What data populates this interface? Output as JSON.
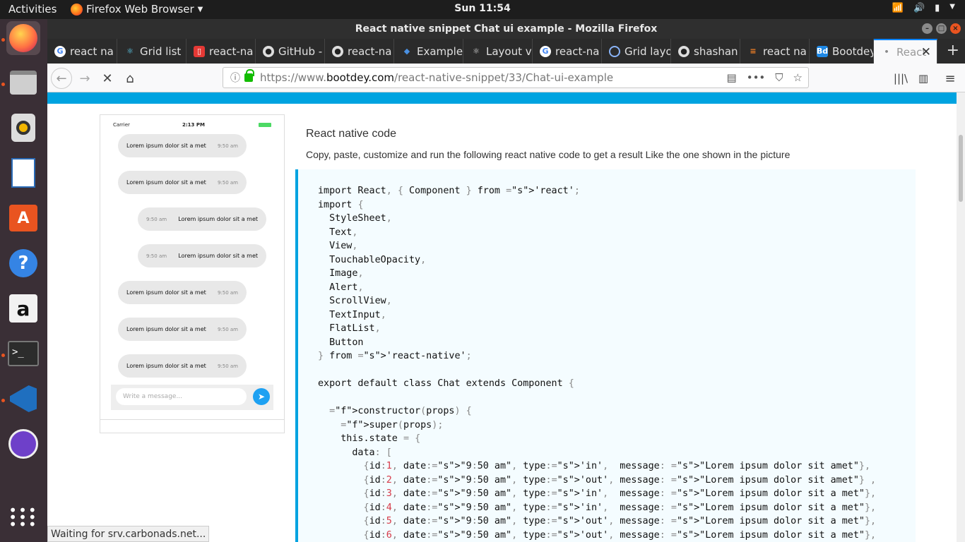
{
  "os": {
    "activities": "Activities",
    "app_name": "Firefox Web Browser",
    "clock": "Sun 11:54"
  },
  "window": {
    "title": "React native snippet Chat ui example - Mozilla Firefox"
  },
  "tabs": [
    {
      "label": "react na",
      "icon": "google-icon"
    },
    {
      "label": "Grid list",
      "icon": "react-icon"
    },
    {
      "label": "react-na",
      "icon": "red-square-icon"
    },
    {
      "label": "GitHub -",
      "icon": "github-icon"
    },
    {
      "label": "react-na",
      "icon": "github-icon"
    },
    {
      "label": "Example",
      "icon": "expo-icon"
    },
    {
      "label": "Layout v",
      "icon": "react-icon"
    },
    {
      "label": "react-na",
      "icon": "google-icon"
    },
    {
      "label": "Grid layo",
      "icon": "circle-icon"
    },
    {
      "label": "shashan",
      "icon": "github-icon"
    },
    {
      "label": "react na",
      "icon": "stackoverflow-icon"
    },
    {
      "label": "Bootdey",
      "icon": "bootdey-icon"
    },
    {
      "label": "React",
      "icon": "loading-icon",
      "active": true
    }
  ],
  "url": {
    "protocol": "https://www.",
    "domain": "bootdey.com",
    "path": "/react-native-snippet/33/Chat-ui-example"
  },
  "phone": {
    "carrier": "Carrier",
    "time": "2:13 PM",
    "messages": [
      {
        "text": "Lorem ipsum dolor sit a met",
        "time": "9:50 am",
        "type": "in"
      },
      {
        "text": "Lorem ipsum dolor sit a met",
        "time": "9:50 am",
        "type": "in"
      },
      {
        "text": "Lorem ipsum dolor sit a met",
        "time": "9:50 am",
        "type": "out"
      },
      {
        "text": "Lorem ipsum dolor sit a met",
        "time": "9:50 am",
        "type": "out"
      },
      {
        "text": "Lorem ipsum dolor sit a met",
        "time": "9:50 am",
        "type": "in"
      },
      {
        "text": "Lorem ipsum dolor sit a met",
        "time": "9:50 am",
        "type": "in"
      },
      {
        "text": "Lorem ipsum dolor sit a met",
        "time": "9:50 am",
        "type": "in"
      }
    ],
    "input_placeholder": "Write a message..."
  },
  "content": {
    "heading": "React native code",
    "description": "Copy, paste, customize and run the following react native code to get a result Like the one shown in the picture"
  },
  "code_lines": [
    "import React, { Component } from 'react';",
    "import {",
    "  StyleSheet,",
    "  Text,",
    "  View,",
    "  TouchableOpacity,",
    "  Image,",
    "  Alert,",
    "  ScrollView,",
    "  TextInput,",
    "  FlatList,",
    "  Button",
    "} from 'react-native';",
    "",
    "export default class Chat extends Component {",
    "",
    "  constructor(props) {",
    "    super(props);",
    "    this.state = {",
    "      data: [",
    "        {id:1, date:\"9:50 am\", type:'in',  message: \"Lorem ipsum dolor sit amet\"},",
    "        {id:2, date:\"9:50 am\", type:'out', message: \"Lorem ipsum dolor sit amet\"} ,",
    "        {id:3, date:\"9:50 am\", type:'in',  message: \"Lorem ipsum dolor sit a met\"},",
    "        {id:4, date:\"9:50 am\", type:'in',  message: \"Lorem ipsum dolor sit a met\"},",
    "        {id:5, date:\"9:50 am\", type:'out', message: \"Lorem ipsum dolor sit a met\"},",
    "        {id:6, date:\"9:50 am\", type:'out', message: \"Lorem ipsum dolor sit a met\"},"
  ],
  "status_text": "Waiting for srv.carbonads.net...",
  "colors": {
    "accent": "#00a3e0",
    "ubuntu_orange": "#e95420",
    "code_bg": "#f4fcff",
    "string_green": "#22863a"
  }
}
